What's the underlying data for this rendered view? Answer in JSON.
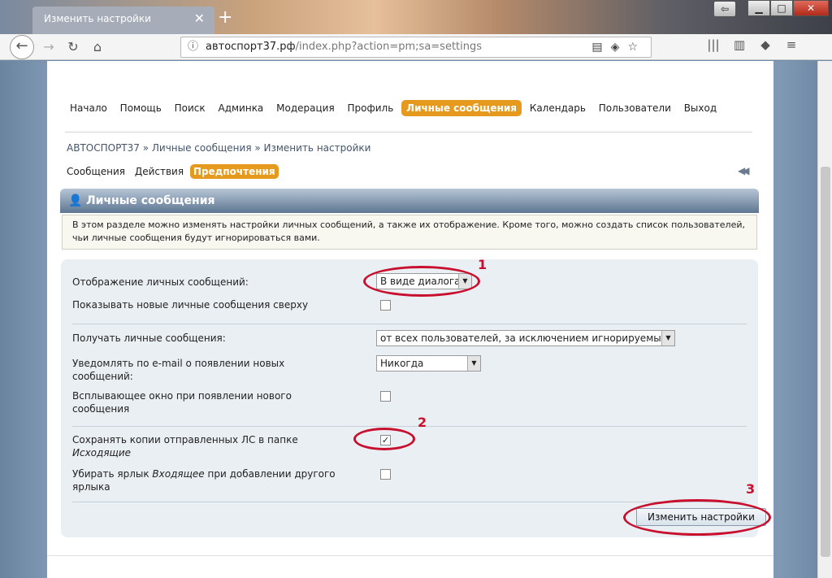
{
  "browser": {
    "tab_title": "Изменить настройки",
    "url_host": "автоспорт37.рф",
    "url_path": "/index.php?action=pm;sa=settings"
  },
  "main_nav": [
    {
      "label": "Начало",
      "active": false
    },
    {
      "label": "Помощь",
      "active": false
    },
    {
      "label": "Поиск",
      "active": false
    },
    {
      "label": "Админка",
      "active": false
    },
    {
      "label": "Модерация",
      "active": false
    },
    {
      "label": "Профиль",
      "active": false
    },
    {
      "label": "Личные сообщения",
      "active": true
    },
    {
      "label": "Календарь",
      "active": false
    },
    {
      "label": "Пользователи",
      "active": false
    },
    {
      "label": "Выход",
      "active": false
    }
  ],
  "breadcrumb": "АВТОСПОРТ37 » Личные сообщения » Изменить настройки",
  "sub_nav": [
    {
      "label": "Сообщения",
      "active": false
    },
    {
      "label": "Действия",
      "active": false
    },
    {
      "label": "Предпочтения",
      "active": true
    }
  ],
  "category_title": "Личные сообщения",
  "description": "В этом разделе можно изменять настройки личных сообщений, а также их отображение. Кроме того, можно создать список пользователей, чьи личные сообщения будут игнорироваться вами.",
  "settings": {
    "display_label": "Отображение личных сообщений:",
    "display_value": "В виде диалога",
    "show_new_top_label": "Показывать новые личные сообщения сверху",
    "show_new_top_checked": false,
    "receive_label": "Получать личные сообщения:",
    "receive_value": "от всех пользователей, за исключением игнорируемых",
    "notify_label": "Уведомлять по e-mail о появлении новых сообщений:",
    "notify_value": "Никогда",
    "popup_label": "Всплывающее окно при появлении нового сообщения",
    "popup_checked": false,
    "save_copies_label_1": "Сохранять копии отправленных ЛС в папке",
    "save_copies_label_2": "Исходящие",
    "save_copies_checked": true,
    "remove_inbox_label_1": "Убирать ярлык ",
    "remove_inbox_label_em": "Входящее",
    "remove_inbox_label_2": " при добавлении другого ярлыка",
    "remove_inbox_checked": false,
    "submit_label": "Изменить настройки"
  },
  "annotations": {
    "color": "#c8102e",
    "num1": "1",
    "num2": "2",
    "num3": "3"
  }
}
